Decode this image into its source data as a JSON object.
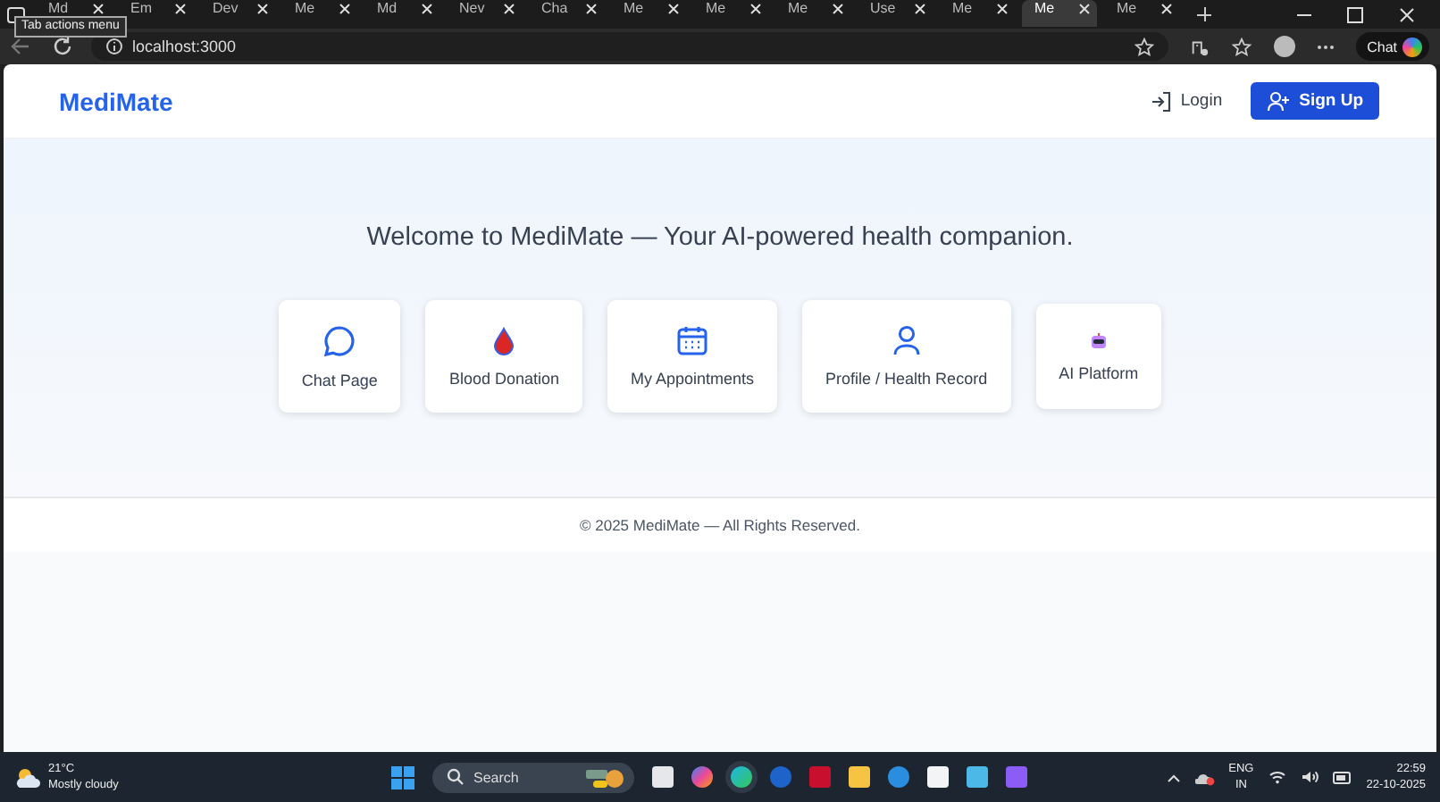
{
  "browser": {
    "tabs": [
      {
        "title": "Md",
        "selected": false
      },
      {
        "title": "Em",
        "selected": false
      },
      {
        "title": "Dev",
        "selected": false
      },
      {
        "title": "Me",
        "selected": false
      },
      {
        "title": "Md",
        "selected": false
      },
      {
        "title": "Nev",
        "selected": false
      },
      {
        "title": "Cha",
        "selected": false
      },
      {
        "title": "Me",
        "selected": false
      },
      {
        "title": "Me",
        "selected": false
      },
      {
        "title": "Me",
        "selected": false
      },
      {
        "title": "Use",
        "selected": false
      },
      {
        "title": "Me",
        "selected": false
      },
      {
        "title": "Me",
        "selected": true
      },
      {
        "title": "Me",
        "selected": false
      }
    ],
    "tooltip": "Tab actions menu",
    "address": "localhost:3000",
    "chat_button": "Chat"
  },
  "header": {
    "brand": "MediMate",
    "login": "Login",
    "signup": "Sign Up"
  },
  "welcome": "Welcome to MediMate — Your AI-powered health companion.",
  "cards": [
    {
      "label": "Chat Page",
      "kind": "chat"
    },
    {
      "label": "Blood Donation",
      "kind": "drop"
    },
    {
      "label": "My Appointments",
      "kind": "calendar"
    },
    {
      "label": "Profile / Health Record",
      "kind": "user"
    },
    {
      "label": "AI Platform",
      "kind": "robot"
    }
  ],
  "footer": "© 2025 MediMate — All Rights Reserved.",
  "taskbar": {
    "temperature": "21°C",
    "condition": "Mostly cloudy",
    "search": "Search",
    "lang": "ENG",
    "region": "IN",
    "time": "22:59",
    "date": "22-10-2025"
  }
}
